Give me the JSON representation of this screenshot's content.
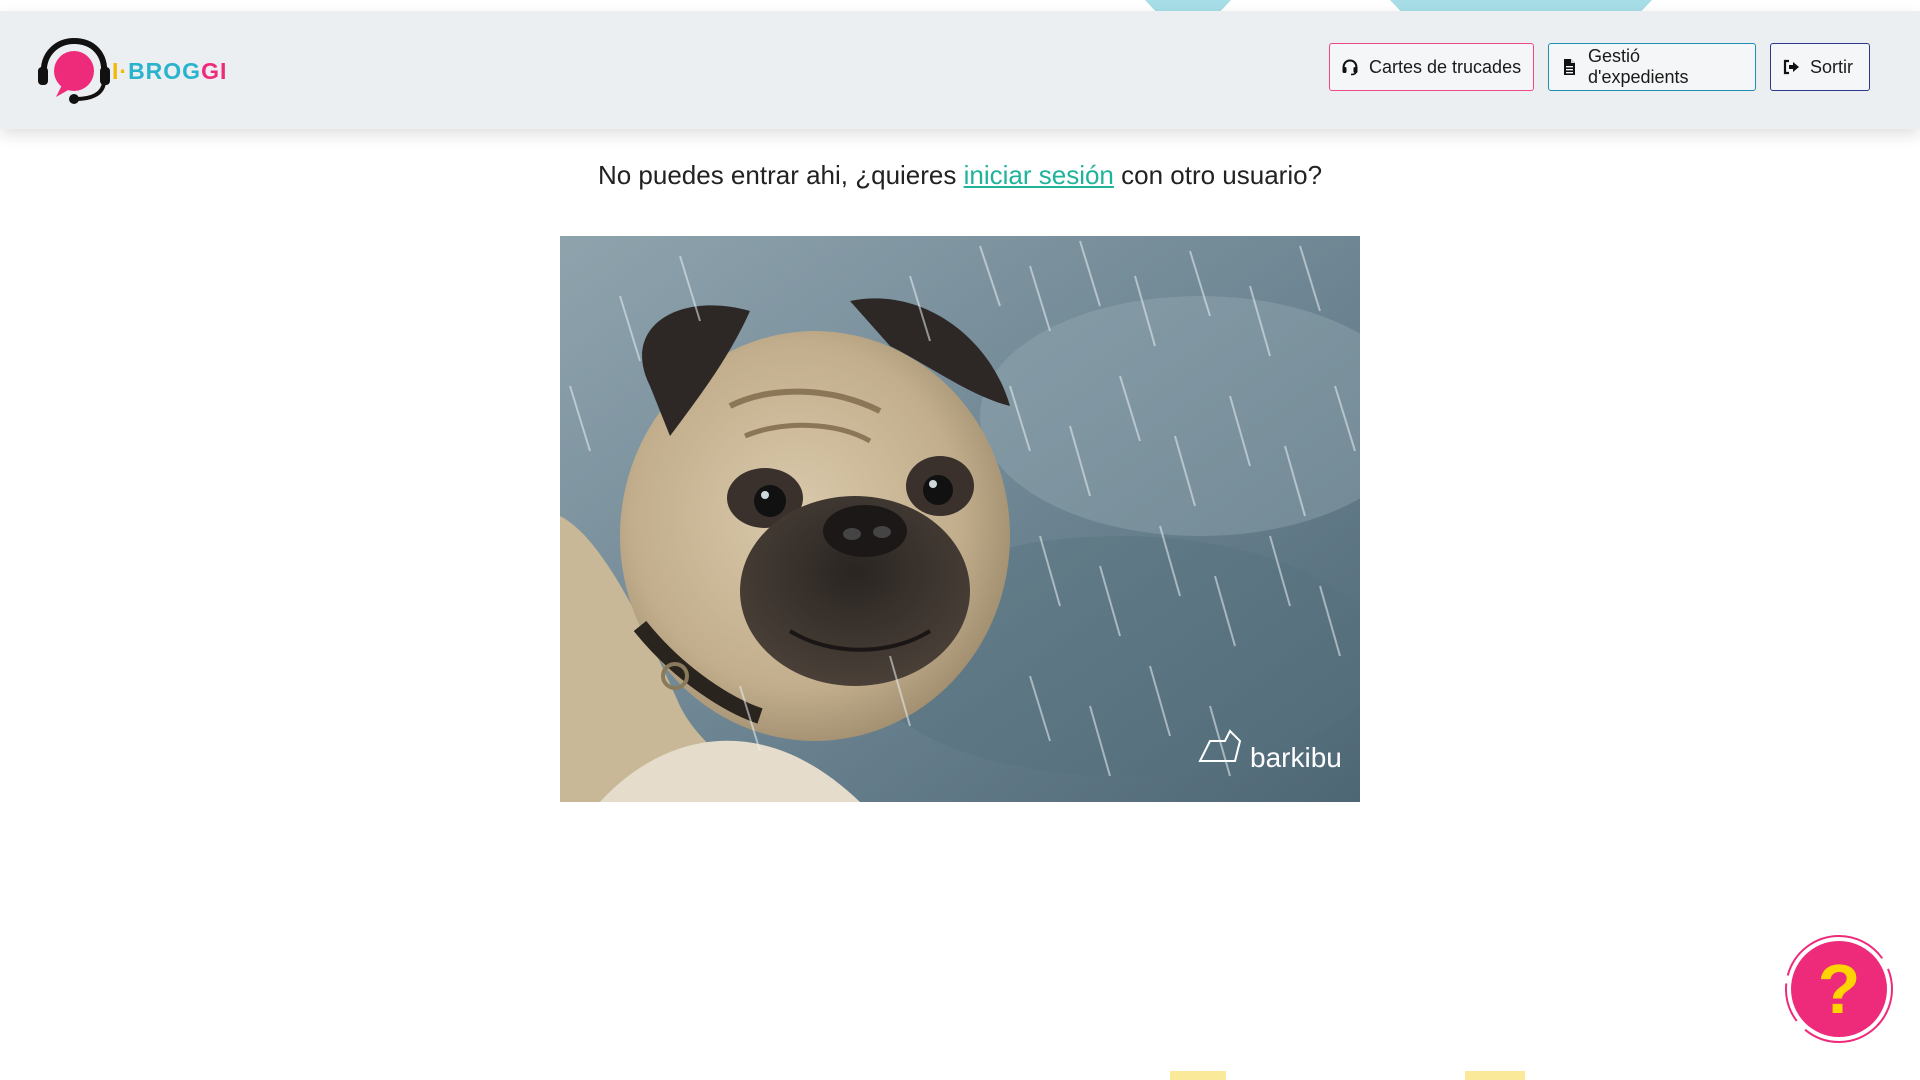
{
  "header": {
    "logo": {
      "icon": "headset-chat-icon",
      "prefix": "I",
      "dot": "·",
      "name_part1": "BROG",
      "name_part2": "GI"
    },
    "nav": [
      {
        "label": "Cartes de trucades",
        "icon": "headset-icon",
        "border_color": "#ee4b86"
      },
      {
        "label": "Gestió d'expedients",
        "icon": "document-icon",
        "border_color": "#1f8fb3"
      },
      {
        "label": "Sortir",
        "icon": "sign-out-icon",
        "border_color": "#2b3a8c"
      }
    ]
  },
  "main": {
    "message_before": "No puedes entrar ahi, ¿quieres ",
    "login_link": "iniciar sesión",
    "message_after": " con otro usuario?",
    "image": {
      "subject": "sad pug in the rain",
      "watermark": "barkibu"
    }
  },
  "help_button": {
    "icon": "question-mark-icon",
    "label": "?"
  },
  "colors": {
    "pink": "#ee2b7b",
    "teal": "#1fb39b",
    "blue": "#1f8fb3",
    "navy": "#2b3a8c",
    "yellow": "#f5b800",
    "header_bg": "#eceff1"
  }
}
